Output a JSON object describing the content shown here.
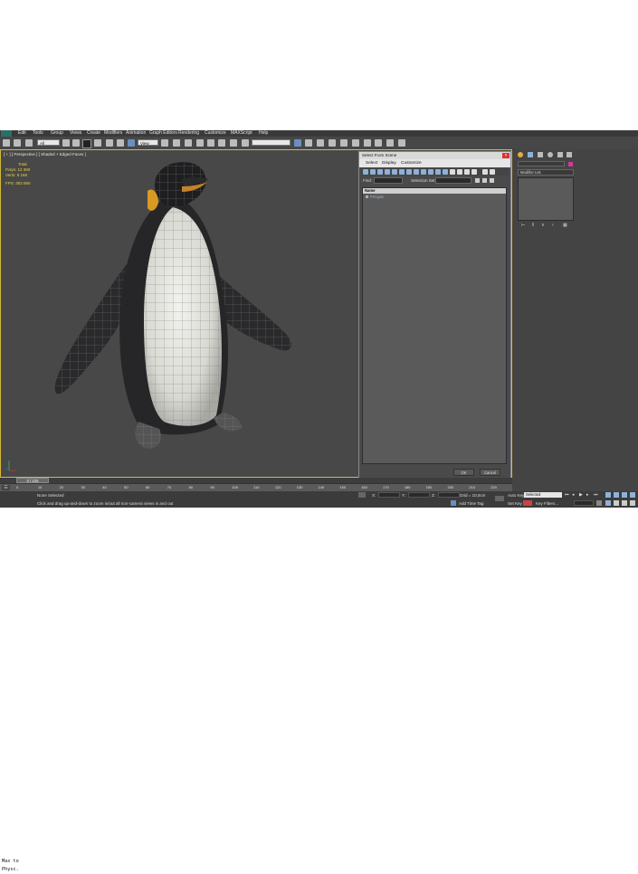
{
  "menu": [
    "Edit",
    "Tools",
    "Group",
    "Views",
    "Create",
    "Modifiers",
    "Animation",
    "Graph Editors",
    "Rendering",
    "Customize",
    "MAXScript",
    "Help"
  ],
  "toolbar": {
    "selection_filter": "All",
    "ref_coord": "View",
    "named_selection": ""
  },
  "viewport": {
    "label": "[ + ] [ Perspective ] [ Shaded + Edged Faces ]",
    "stats": {
      "header": "Total",
      "polys_label": "Polys:",
      "polys": "12 360",
      "verts_label": "Verts:",
      "verts": "6 169",
      "fps_label": "FPS:",
      "fps": "302.560"
    }
  },
  "dialog": {
    "title": "Select From Scene",
    "tabs": [
      "Select",
      "Display",
      "Customize"
    ],
    "find_label": "Find:",
    "selection_set_label": "Selection Set:",
    "column_header": "Name",
    "items": [
      "Penguin"
    ],
    "ok_label": "OK",
    "cancel_label": "Cancel"
  },
  "command_panel": {
    "modifier_list": "Modifier List"
  },
  "timeline": {
    "frame": "0 / 225",
    "ticks": [
      "0",
      "10",
      "20",
      "30",
      "40",
      "50",
      "60",
      "70",
      "80",
      "90",
      "100",
      "110",
      "120",
      "130",
      "140",
      "150",
      "160",
      "170",
      "180",
      "190",
      "200",
      "210",
      "220"
    ]
  },
  "status": {
    "selection": "None Selected",
    "prompt": "Click and drag up-and-down to zoom in/out all non-camera views in and out",
    "maxscript_mini": "Max to Physc.",
    "grid": "Grid = 10,0cm",
    "add_time_tag": "Add Time Tag",
    "x_label": "X:",
    "y_label": "Y:",
    "z_label": "Z:",
    "auto_key": "Auto Key",
    "auto_key_value": "Selected",
    "set_key": "Set Key",
    "key_filters": "Key Filters..."
  }
}
